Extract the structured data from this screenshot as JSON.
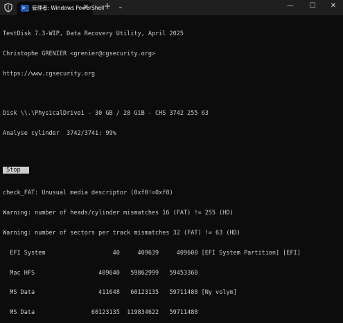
{
  "window": {
    "tab_title": "管理者: Windows PowerShell",
    "tab_icon_glyph": ">_",
    "new_tab_glyph": "+",
    "dropdown_glyph": "⌄",
    "minimize_glyph": "—",
    "maximize_glyph": "☐",
    "close_glyph": "✕",
    "tab_close_glyph": "✕"
  },
  "console": {
    "lines": [
      "TestDisk 7.3-WIP, Data Recovery Utility, April 2025",
      "Christophe GRENIER <grenier@cgsecurity.org>",
      "https://www.cgsecurity.org",
      "",
      "Disk \\\\.\\PhysicalDrive1 - 30 GB / 28 GiB - CHS 3742 255 63",
      "Analyse cylinder  3742/3741: 99%",
      "",
      "",
      "check_FAT: Unusual media descriptor (0xf0!=0xf8)",
      "Warning: number of heads/cylinder mismatches 16 (FAT) != 255 (HD)",
      "Warning: number of sectors per track mismatches 32 (FAT) != 63 (HD)",
      "  EFI System                   40     409639     409600 [EFI System Partition] [EFI]",
      "  Mac HFS                  409640   59862999   59453360",
      "  MS Data                  411648   60123135   59711488 [Ny volym]",
      "  MS Data                60123135  119834622   59711488"
    ],
    "stop_label": " Stop "
  },
  "colors": {
    "terminal_bg": "#0c0c0c",
    "terminal_fg": "#cccccc",
    "titlebar_bg": "#1f1f1f"
  }
}
